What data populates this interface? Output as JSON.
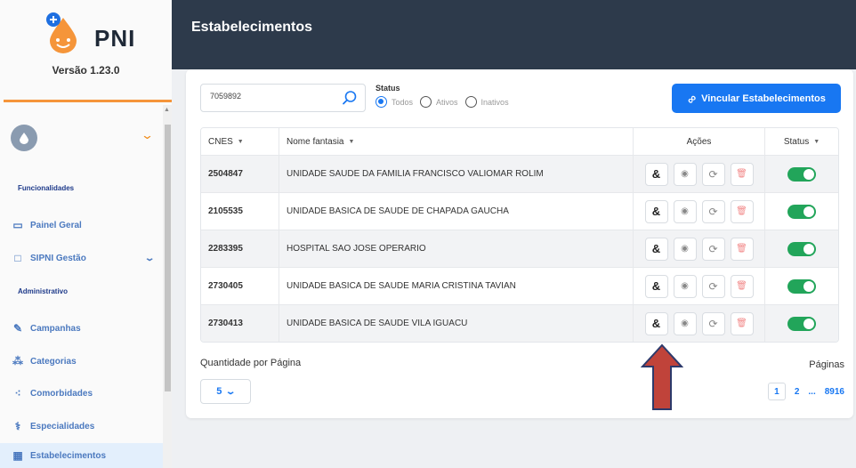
{
  "app": {
    "name": "PNI",
    "version": "Versão 1.23.0"
  },
  "sidebar": {
    "sections": {
      "funcionalidades": "Funcionalidades",
      "administrativo": "Administrativo"
    },
    "items": [
      {
        "label": "Painel Geral",
        "icon": "monitor-icon"
      },
      {
        "label": "SIPNI Gestão",
        "icon": "laptop-icon"
      },
      {
        "label": "Campanhas",
        "icon": "syringe-icon"
      },
      {
        "label": "Categorias",
        "icon": "people-group-icon"
      },
      {
        "label": "Comorbidades",
        "icon": "network-icon"
      },
      {
        "label": "Especialidades",
        "icon": "doctor-icon"
      },
      {
        "label": "Estabelecimentos",
        "icon": "building-icon"
      }
    ]
  },
  "header": {
    "title": "Estabelecimentos"
  },
  "filters": {
    "search_value": "7059892",
    "status_label": "Status",
    "options": [
      "Todos",
      "Ativos",
      "Inativos"
    ],
    "selected": "Todos"
  },
  "actions": {
    "link_button": "Vincular Estabelecimentos"
  },
  "table": {
    "headers": {
      "cnes": "CNES",
      "nome": "Nome fantasia",
      "acoes": "Ações",
      "status": "Status"
    },
    "rows": [
      {
        "cnes": "2504847",
        "nome": "UNIDADE SAUDE DA FAMILIA FRANCISCO VALIOMAR ROLIM",
        "active": true
      },
      {
        "cnes": "2105535",
        "nome": "UNIDADE BASICA DE SAUDE DE CHAPADA GAUCHA",
        "active": true
      },
      {
        "cnes": "2283395",
        "nome": "HOSPITAL SAO JOSE OPERARIO",
        "active": true
      },
      {
        "cnes": "2730405",
        "nome": "UNIDADE BASICA DE SAUDE MARIA CRISTINA TAVIAN",
        "active": true
      },
      {
        "cnes": "2730413",
        "nome": "UNIDADE BASICA DE SAUDE VILA IGUACU",
        "active": true
      }
    ]
  },
  "pagination": {
    "qty_label": "Quantidade por Página",
    "qty_value": "5",
    "pages_label": "Páginas",
    "pages": [
      "1",
      "2",
      "...",
      "8916"
    ],
    "current": "1"
  },
  "colors": {
    "header_bg": "#2d3a4b",
    "accent_blue": "#1877f2",
    "accent_orange": "#f5953a",
    "toggle_green": "#22a55a",
    "annotation_arrow": "#c0433a"
  }
}
